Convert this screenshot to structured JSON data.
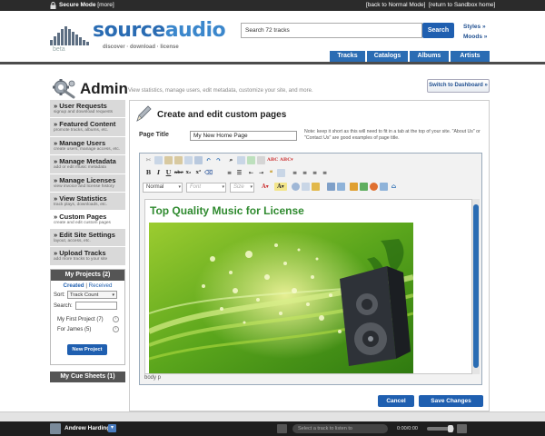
{
  "topbar": {
    "secure_label": "Secure Mode",
    "more_label": "[more]",
    "normal_mode": "[back to Normal Mode]",
    "sandbox": "[return to Sandbox home]"
  },
  "header": {
    "logo_source": "source",
    "logo_audio": "audio",
    "tagline": "discover · download · license",
    "beta": "beta",
    "search_value": "Search 72 tracks",
    "search_button": "Search",
    "styles_link": "Styles »",
    "moods_link": "Moods »"
  },
  "nav": {
    "tabs": [
      "Tracks",
      "Catalogs",
      "Albums",
      "Artists"
    ]
  },
  "admin": {
    "title": "Admin",
    "description": "View statistics, manage users, edit metadata, customize your site, and more.",
    "dashboard_button": "Switch to Dashboard »"
  },
  "sidebar": {
    "items": [
      {
        "label": "» User Requests",
        "desc": "signup and download requests"
      },
      {
        "label": "» Featured Content",
        "desc": "promote tracks, albums, etc."
      },
      {
        "label": "» Manage Users",
        "desc": "create users, manage access, etc."
      },
      {
        "label": "» Manage Metadata",
        "desc": "add or edit music metadata"
      },
      {
        "label": "» Manage Licenses",
        "desc": "view invoice and license history"
      },
      {
        "label": "» View Statistics",
        "desc": "track plays, downloads, etc."
      },
      {
        "label": "» Custom Pages",
        "desc": "create and edit custom pages"
      },
      {
        "label": "» Edit Site Settings",
        "desc": "layout, access, etc."
      },
      {
        "label": "» Upload Tracks",
        "desc": "add more tracks to your site"
      }
    ]
  },
  "projects": {
    "header": "My Projects (2)",
    "tab_created": "Created",
    "tab_sep": " | ",
    "tab_received": "Received",
    "sort_label": "Sort:",
    "sort_value": "Track Count",
    "search_label": "Search:",
    "items": [
      "My First Project (7)",
      "For James (5)"
    ],
    "new_button": "New Project"
  },
  "cue_sheets": "My Cue Sheets (1)",
  "page": {
    "title": "Create and edit custom pages",
    "page_title_label": "Page Title",
    "page_title_value": "My New Home Page",
    "note": "Note: keep it short as this will need to fit in a tab at the top of your site. \"About Us\" or \"Contact Us\" are good examples of page title."
  },
  "editor": {
    "format_combo": "Normal",
    "font_combo": "Font",
    "size_combo": "Size",
    "content_heading": "Top Quality Music for License",
    "status_path": "body  p"
  },
  "actions": {
    "cancel": "Cancel",
    "save": "Save Changes"
  },
  "player": {
    "user_name": "Andrew Harding",
    "track_placeholder": "Select a track to listen to",
    "time": "0:00/0:00"
  },
  "colors": {
    "brand_blue": "#2a6cb3",
    "button_blue": "#1f5fb0",
    "heading_green": "#2f8a2f"
  }
}
